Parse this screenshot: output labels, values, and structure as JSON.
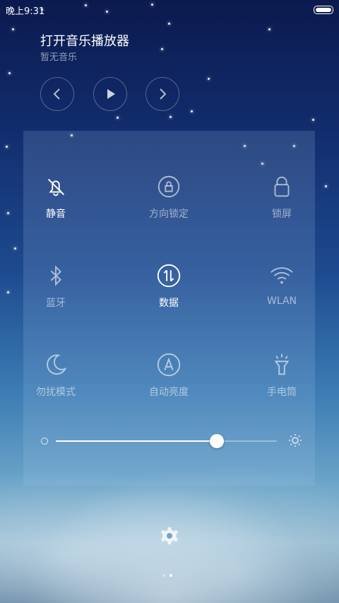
{
  "status_bar": {
    "time": "晚上9:31"
  },
  "music": {
    "title": "打开音乐播放器",
    "subtitle": "暂无音乐",
    "prev_icon": "chevron-left-icon",
    "play_icon": "play-icon",
    "next_icon": "chevron-right-icon"
  },
  "toggles": [
    {
      "label": "静音",
      "icon": "bell-off-icon",
      "active": true
    },
    {
      "label": "方向锁定",
      "icon": "rotation-lock-icon",
      "active": false
    },
    {
      "label": "锁屏",
      "icon": "lock-icon",
      "active": false
    },
    {
      "label": "蓝牙",
      "icon": "bluetooth-icon",
      "active": false
    },
    {
      "label": "数据",
      "icon": "mobile-data-icon",
      "active": true
    },
    {
      "label": "WLAN",
      "icon": "wifi-icon",
      "active": false
    },
    {
      "label": "勿扰模式",
      "icon": "moon-icon",
      "active": false
    },
    {
      "label": "自动亮度",
      "icon": "auto-brightness-icon",
      "active": false
    },
    {
      "label": "手电筒",
      "icon": "flashlight-icon",
      "active": false
    }
  ],
  "brightness": {
    "value_percent": 73,
    "min_icon": "circle-icon",
    "max_icon": "sun-icon"
  },
  "page_indicator": {
    "pages": 2,
    "current": 2
  },
  "settings_icon": "gear-icon"
}
